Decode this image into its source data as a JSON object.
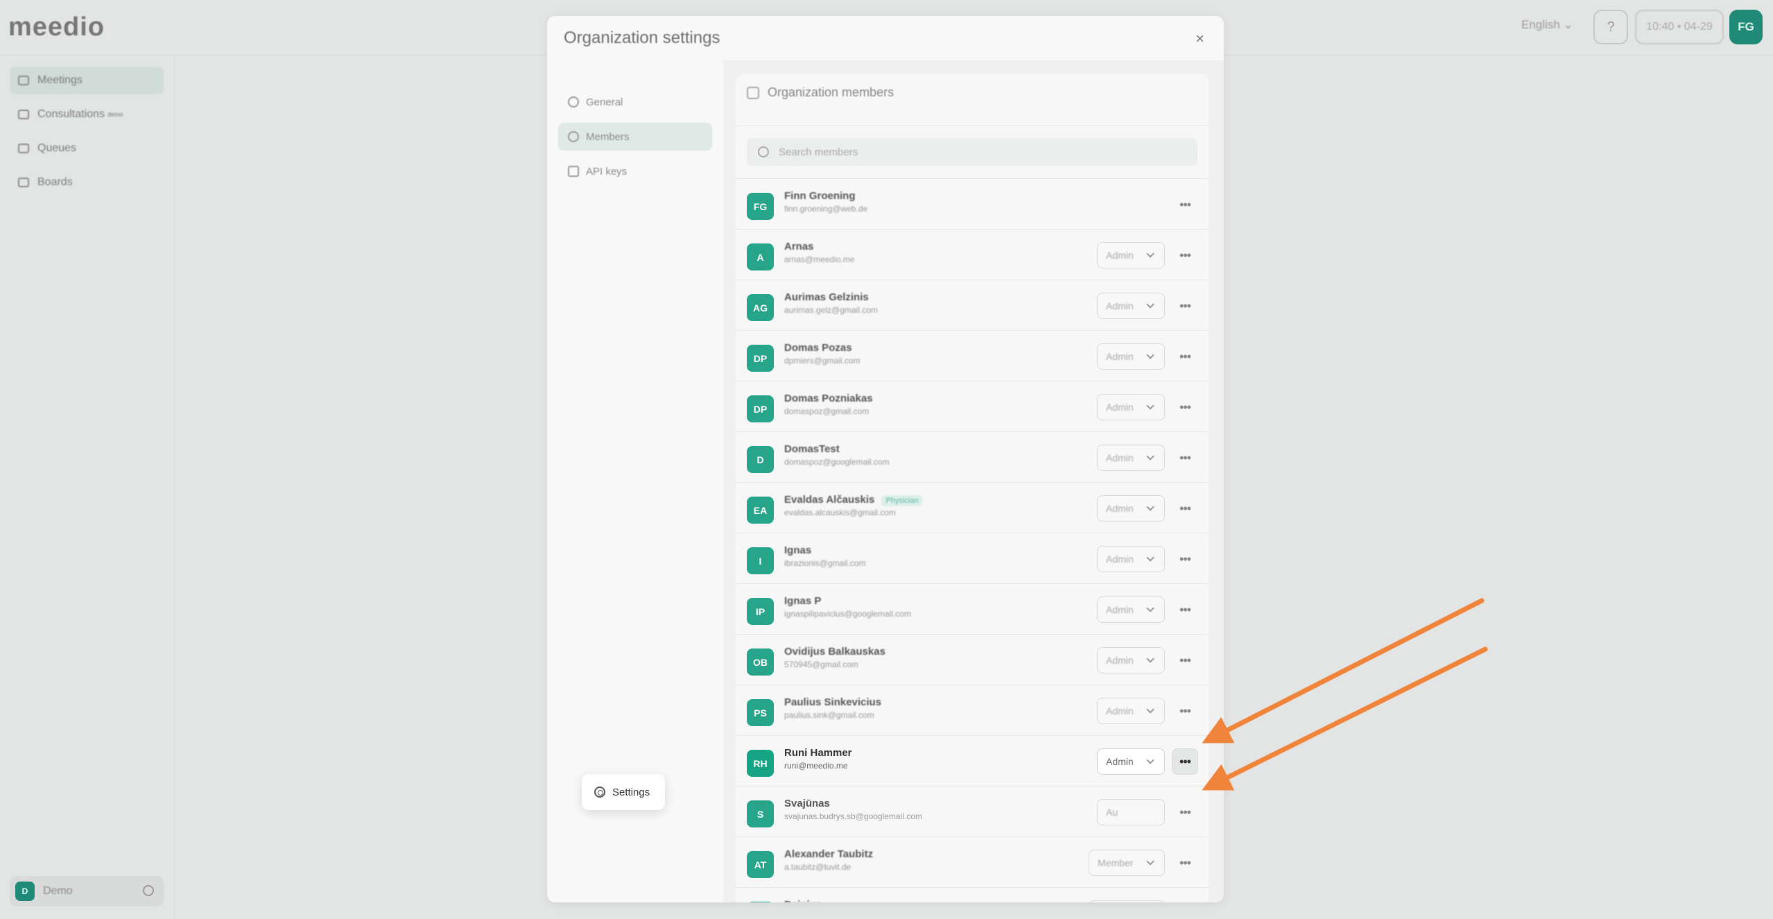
{
  "app": {
    "logo": "meedio",
    "language": "English",
    "clock": "10:40 • 04-29",
    "user_initials": "FG",
    "help_icon": "help-circle-icon"
  },
  "sidebar": {
    "items": [
      {
        "label": "Meetings",
        "icon": "video-icon",
        "active": true
      },
      {
        "label": "Consultations",
        "suffix": "demo",
        "icon": "consult-icon"
      },
      {
        "label": "Queues",
        "icon": "queue-icon"
      },
      {
        "label": "Boards",
        "icon": "grid-icon"
      }
    ],
    "workspace": {
      "initial": "D",
      "label": "Demo"
    }
  },
  "modal": {
    "title": "Organization settings",
    "close": "×",
    "nav": [
      {
        "label": "General",
        "icon": "gear-icon"
      },
      {
        "label": "Members",
        "icon": "users-icon",
        "active": true
      },
      {
        "label": "API keys",
        "icon": "key-icon"
      }
    ],
    "members_panel": {
      "title": "Organization members",
      "search_placeholder": "Search members",
      "members": [
        {
          "initials": "FG",
          "name": "Finn Groening",
          "email": "finn.groening@web.de",
          "role": ""
        },
        {
          "initials": "A",
          "name": "Arnas",
          "email": "arnas@meedio.me",
          "role": "Admin"
        },
        {
          "initials": "AG",
          "name": "Aurimas Gelzinis",
          "email": "aurimas.gelz@gmail.com",
          "role": "Admin"
        },
        {
          "initials": "DP",
          "name": "Domas Pozas",
          "email": "dpmiers@gmail.com",
          "role": "Admin"
        },
        {
          "initials": "DP",
          "name": "Domas Pozniakas",
          "email": "domaspoz@gmail.com",
          "role": "Admin"
        },
        {
          "initials": "D",
          "name": "DomasTest",
          "email": "domaspoz@googlemail.com",
          "role": "Admin"
        },
        {
          "initials": "EA",
          "name": "Evaldas Alčauskis",
          "badge": "Physician",
          "email": "evaldas.alcauskis@gmail.com",
          "role": "Admin"
        },
        {
          "initials": "I",
          "name": "Ignas",
          "email": "ibrazionis@gmail.com",
          "role": "Admin"
        },
        {
          "initials": "IP",
          "name": "Ignas P",
          "email": "ignaspilipavicius@googlemail.com",
          "role": "Admin"
        },
        {
          "initials": "OB",
          "name": "Ovidijus Balkauskas",
          "email": "570945@gmail.com",
          "role": "Admin"
        },
        {
          "initials": "PS",
          "name": "Paulius Sinkevicius",
          "email": "paulius.sink@gmail.com",
          "role": "Admin"
        },
        {
          "initials": "RH",
          "name": "Runi Hammer",
          "email": "runi@meedio.me",
          "role": "Admin",
          "focus": true
        },
        {
          "initials": "S",
          "name": "Svajūnas",
          "email": "svajunas.budrys.sb@googlemail.com",
          "role": "Au"
        },
        {
          "initials": "AT",
          "name": "Alexander Taubitz",
          "email": "a.taubitz@tuvit.de",
          "role": "Member"
        },
        {
          "initials": "D",
          "name": "Dainius",
          "email": "",
          "role": "Member"
        }
      ],
      "more_label": "•••"
    },
    "context_menu": {
      "item": "Settings",
      "icon": "gear-icon"
    }
  },
  "annotation": {
    "color": "#f0843a"
  }
}
